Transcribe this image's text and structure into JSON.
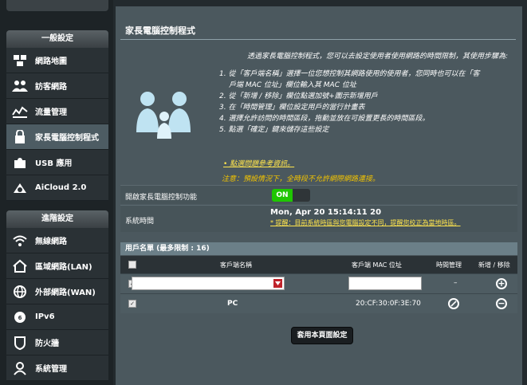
{
  "sidebar": {
    "general_section": "一般設定",
    "advanced_section": "進階設定",
    "general_items": [
      {
        "label": "網路地圖"
      },
      {
        "label": "訪客網路"
      },
      {
        "label": "流量管理"
      },
      {
        "label": "家長電腦控制程式"
      },
      {
        "label": "USB 應用"
      },
      {
        "label": "AiCloud 2.0"
      }
    ],
    "advanced_items": [
      {
        "label": "無線網路"
      },
      {
        "label": "區域網路(LAN)"
      },
      {
        "label": "外部網路(WAN)"
      },
      {
        "label": "IPv6"
      },
      {
        "label": "防火牆"
      },
      {
        "label": "系統管理"
      }
    ]
  },
  "main": {
    "title": "家長電腦控制程式",
    "intro": "透過家長電腦控制程式，您可以去設定使用者使用網路的時間限制，其使用步驟為:",
    "steps": [
      "1. 從「客戶端名稱」選擇一位您想控制其網路使用的使用者，您同時也可以在「客",
      "戶端 MAC 位址」欄位輸入其 MAC 位址",
      "2. 從「新增 / 移除」欄位點選加號+圖示新增用戶",
      "3. 在「時間管理」欄位設定用戶的當行計畫表",
      "4. 選擇允許訪問的時間區段，拖動並放在可設置更長的時間區段。",
      "5. 點選「確定」鍵來儲存這些設定"
    ],
    "faq_link": "• 點選問題參考資訊。",
    "note": "注意：預設情況下，全時段不允許網際網路連接。"
  },
  "settings": {
    "enable_label": "開啟家長電腦控制功能",
    "enable_value": "ON",
    "systime_label": "系統時間",
    "systime_value": "Mon, Apr 20  15:14:11  20",
    "systime_warning": "* 提醒：目前系統時區與您電腦設定不同，提醒您校正為當地時區。"
  },
  "client_table": {
    "header": "用戶名單 (最多限制 : 16)",
    "columns": [
      "客戶端名稱",
      "客戶端 MAC 位址",
      "時間管理",
      "新增 / 移除"
    ],
    "new_row": {
      "time": "–"
    },
    "rows": [
      {
        "name": "PC",
        "mac": "20:CF:30:0F:3E:70"
      }
    ]
  },
  "apply_button": "套用本頁面設定",
  "colors": {
    "accent_green": "#1fc600",
    "highlight_yellow": "#ffe54d",
    "select_arrow_red": "#c0232b"
  }
}
